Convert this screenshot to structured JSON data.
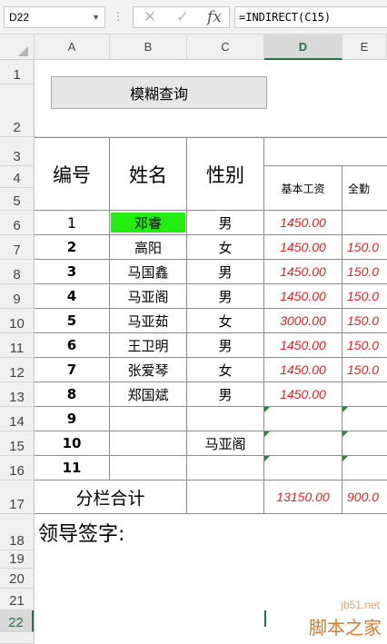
{
  "formula_bar": {
    "name_box": "D22",
    "separator": "⋮",
    "cancel_glyph": "✕",
    "enter_glyph": "✓",
    "fx_label": "fx",
    "formula": "=INDIRECT(C15)"
  },
  "columns": [
    "A",
    "B",
    "C",
    "D",
    "E"
  ],
  "active_column": "D",
  "rows": [
    "1",
    "2",
    "3",
    "4",
    "5",
    "6",
    "7",
    "8",
    "9",
    "10",
    "11",
    "12",
    "13",
    "14",
    "15",
    "16",
    "17",
    "18",
    "19",
    "20",
    "21",
    "22"
  ],
  "active_row": "22",
  "query_button_label": "模糊查询",
  "table": {
    "header_id": "编号",
    "header_name": "姓名",
    "header_gender": "性别",
    "header_base_salary": "基本工资",
    "header_attendance": "全勤",
    "records": [
      {
        "id": "1",
        "name": "邓睿",
        "gender": "男",
        "base": "1450.00",
        "attend": ""
      },
      {
        "id": "2",
        "name": "高阳",
        "gender": "女",
        "base": "1450.00",
        "attend": "150.0"
      },
      {
        "id": "3",
        "name": "马国鑫",
        "gender": "男",
        "base": "1450.00",
        "attend": "150.0"
      },
      {
        "id": "4",
        "name": "马亚阁",
        "gender": "男",
        "base": "1450.00",
        "attend": "150.0"
      },
      {
        "id": "5",
        "name": "马亚茹",
        "gender": "女",
        "base": "3000.00",
        "attend": "150.0"
      },
      {
        "id": "6",
        "name": "王卫明",
        "gender": "男",
        "base": "1450.00",
        "attend": "150.0"
      },
      {
        "id": "7",
        "name": "张爱琴",
        "gender": "女",
        "base": "1450.00",
        "attend": "150.0"
      },
      {
        "id": "8",
        "name": "郑国斌",
        "gender": "男",
        "base": "1450.00",
        "attend": ""
      },
      {
        "id": "9",
        "name": "",
        "gender": "",
        "base": "",
        "attend": ""
      },
      {
        "id": "10",
        "name": "",
        "gender": "马亚阁",
        "base": "",
        "attend": ""
      },
      {
        "id": "11",
        "name": "",
        "gender": "",
        "base": "",
        "attend": ""
      }
    ],
    "subtotal_label": "分栏合计",
    "subtotal_base": "13150.00",
    "subtotal_attend": "900.0"
  },
  "sign_label": "领导签字:",
  "watermark": {
    "url": "jb51.net",
    "name": "脚本之家"
  },
  "colors": {
    "highlight": "#22ee11",
    "money": "#e02020",
    "accent": "#217346"
  }
}
